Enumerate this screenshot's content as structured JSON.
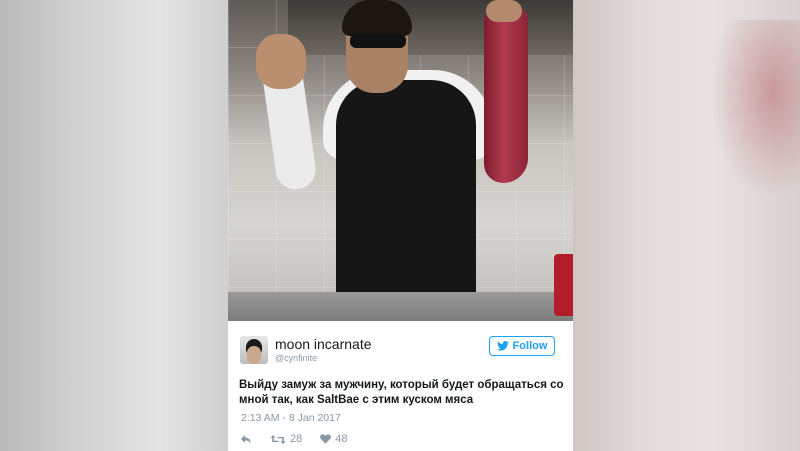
{
  "tweet": {
    "user_name": "moon incarnate",
    "user_handle": "@cynfinite",
    "follow_label": "Follow",
    "text": "Выйду замуж за мужчину, который будет обращаться со мной так, как SaltBae с этим куском мяса",
    "timestamp": "2:13 AM - 8 Jan 2017",
    "retweets": "28",
    "likes": "48"
  },
  "colors": {
    "twitter_blue": "#1da1f2",
    "meta_gray": "#8899a6"
  },
  "icons": [
    "twitter-bird-icon",
    "reply-icon",
    "retweet-icon",
    "heart-icon"
  ]
}
